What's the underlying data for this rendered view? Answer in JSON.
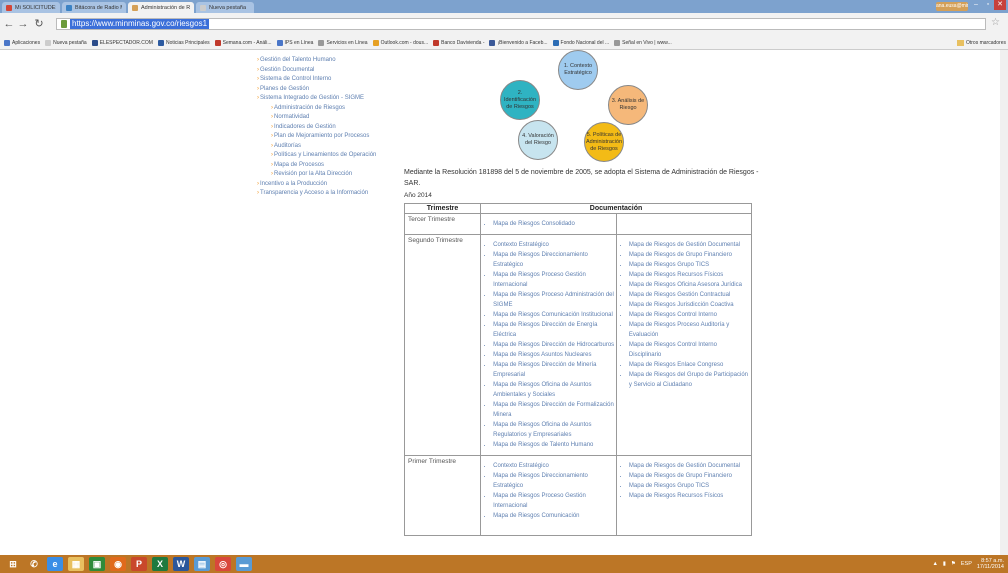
{
  "browser": {
    "tabs": [
      {
        "label": "Mi SOLICITUDES DE PAPOPV ×",
        "color": "#d44638"
      },
      {
        "label": "Bitácora de Radio Min",
        "color": "#3b82c4"
      },
      {
        "label": "Administración de Riesgo ×",
        "color": "#d4a058",
        "active": true
      },
      {
        "label": "Nueva pestaña",
        "color": "#cccccc"
      }
    ],
    "user_badge": "ana.eusa@mine...",
    "url": "https://www.minminas.gov.co/riesgos1",
    "bookmarks": [
      {
        "label": "Aplicaciones",
        "color": "#4a76c8"
      },
      {
        "label": "Nueva pestaña",
        "color": "#cccccc"
      },
      {
        "label": "ELESPECTADOR.COM",
        "color": "#2b4c8a"
      },
      {
        "label": "Noticias Principales",
        "color": "#2c5aa0"
      },
      {
        "label": "Semana.com - Análi...",
        "color": "#c0392b"
      },
      {
        "label": "IPS en Línea",
        "color": "#4a76c8"
      },
      {
        "label": "Servicios en Línea",
        "color": "#999999"
      },
      {
        "label": "Outlook.com - dous...",
        "color": "#e6a023"
      },
      {
        "label": "Banco Davivienda -",
        "color": "#c0392b"
      },
      {
        "label": "¡Bienvenido a Faceb...",
        "color": "#3b5998"
      },
      {
        "label": "Fondo Nacional del ...",
        "color": "#2c6db5"
      },
      {
        "label": "Señal en Vivo | www...",
        "color": "#999999"
      }
    ],
    "other_bookmarks": "Otros marcadores"
  },
  "menu": [
    {
      "label": "Gestión del Talento Humano",
      "level": 0
    },
    {
      "label": "Gestión Documental",
      "level": 0
    },
    {
      "label": "Sistema de Control Interno",
      "level": 0
    },
    {
      "label": "Planes de Gestión",
      "level": 0
    },
    {
      "label": "Sistema Integrado de Gestión - SIGME",
      "level": 0
    },
    {
      "label": "Administración de Riesgos",
      "level": 1
    },
    {
      "label": "Normatividad",
      "level": 1
    },
    {
      "label": "Indicadores de Gestión",
      "level": 1
    },
    {
      "label": "Plan de Mejoramiento por Procesos",
      "level": 1
    },
    {
      "label": "Auditorías",
      "level": 1
    },
    {
      "label": "Políticas y Lineamientos de Operación",
      "level": 1
    },
    {
      "label": "Mapa de Procesos",
      "level": 1
    },
    {
      "label": "Revisión por la Alta Dirección",
      "level": 1
    },
    {
      "label": "Incentivo a la Producción",
      "level": 0
    },
    {
      "label": "Transparencia y Acceso a la Información",
      "level": 0
    }
  ],
  "diagram": {
    "circles": [
      {
        "label": "1. Contexto Estratégico",
        "color": "#9fcbef"
      },
      {
        "label": "2. Identificación de Riesgos",
        "color": "#2fb3c2"
      },
      {
        "label": "3. Análisis de Riesgo",
        "color": "#f5b87a"
      },
      {
        "label": "4. Valoración del Riesgo",
        "color": "#c7e4ef"
      },
      {
        "label": "5. Políticas de Administración de Riesgos",
        "color": "#f3bb16"
      }
    ]
  },
  "intro": "Mediante la Resolución 181898 del 5 de noviembre de 2005, se adopta el Sistema de Administración de Riesgos - SAR.",
  "year_label": "Año 2014",
  "table": {
    "headers": [
      "Trimestre",
      "Documentación"
    ],
    "rows": [
      {
        "trimestre": "Tercer Trimestre",
        "col1": [
          "Mapa de Riesgos Consolidado"
        ],
        "col2": []
      },
      {
        "trimestre": "Segundo Trimestre",
        "col1": [
          "Contexto Estratégico",
          "Mapa de Riesgos Direccionamiento Estratégico",
          "Mapa de Riesgos Proceso Gestión Internacional",
          "Mapa de Riesgos Proceso Administración del SIGME",
          "Mapa de Riesgos Comunicación Institucional",
          "Mapa de Riesgos Dirección de Energía Eléctrica",
          "Mapa de Riesgos Dirección de Hidrocarburos",
          "Mapa de Riesgos Asuntos Nucleares",
          "Mapa de Riesgos Dirección de Minería Empresarial",
          "Mapa de Riesgos Oficina de Asuntos Ambientales y Sociales",
          "Mapa de Riesgos Dirección de Formalización Minera",
          "Mapa de Riesgos Oficina de Asuntos Regulatorios y Empresariales",
          "Mapa de Riesgos de Talento Humano"
        ],
        "col2": [
          "Mapa de Riesgos de Gestión Documental",
          "Mapa de Riesgos de Grupo Financiero",
          "Mapa de Riesgos Grupo TICS",
          "Mapa de Riesgos Recursos Físicos",
          "Mapa de Riesgos Oficina Asesora Jurídica",
          "Mapa de Riesgos Gestión Contractual",
          "Mapa de Riesgos Jurisdicción Coactiva",
          "Mapa de Riesgos Control Interno",
          "Mapa de Riesgos Proceso Auditoría y Evaluación",
          "Mapa de Riesgos Control Interno Disciplinario",
          "Mapa de Riesgos Enlace Congreso",
          "Mapa de Riesgos del Grupo de Participación y Servicio al Ciudadano"
        ]
      },
      {
        "trimestre": "Primer Trimestre",
        "col1": [
          "Contexto Estratégico",
          "Mapa de Riesgos Direccionamiento Estratégico",
          "Mapa de Riesgos Proceso Gestión Internacional",
          "Mapa de Riesgos Comunicación"
        ],
        "col2": [
          "Mapa de Riesgos de Gestión Documental",
          "Mapa de Riesgos de Grupo Financiero",
          "Mapa de Riesgos Grupo TICS",
          "Mapa de Riesgos Recursos Físicos"
        ]
      }
    ]
  },
  "taskbar": {
    "apps": [
      {
        "name": "start-icon",
        "glyph": "⊞",
        "color": "#bc7626"
      },
      {
        "name": "support-icon",
        "glyph": "✆",
        "color": "#bc7626"
      },
      {
        "name": "ie-icon",
        "glyph": "e",
        "color": "#3a8ee6"
      },
      {
        "name": "explorer-icon",
        "glyph": "▦",
        "color": "#e8c060"
      },
      {
        "name": "store-icon",
        "glyph": "▣",
        "color": "#2e8b3a"
      },
      {
        "name": "firefox-icon",
        "glyph": "◉",
        "color": "#e06a1c"
      },
      {
        "name": "powerpoint-icon",
        "glyph": "P",
        "color": "#c9482b"
      },
      {
        "name": "excel-icon",
        "glyph": "X",
        "color": "#1f7a3f"
      },
      {
        "name": "word-icon",
        "glyph": "W",
        "color": "#2b579a"
      },
      {
        "name": "notes-icon",
        "glyph": "▤",
        "color": "#5a9bd4"
      },
      {
        "name": "chrome-icon",
        "glyph": "◎",
        "color": "#d9473c"
      },
      {
        "name": "folder-icon",
        "glyph": "▬",
        "color": "#5a9bd4"
      }
    ],
    "lang": "ESP",
    "time": "8:57 a.m.",
    "date": "17/11/2014"
  }
}
